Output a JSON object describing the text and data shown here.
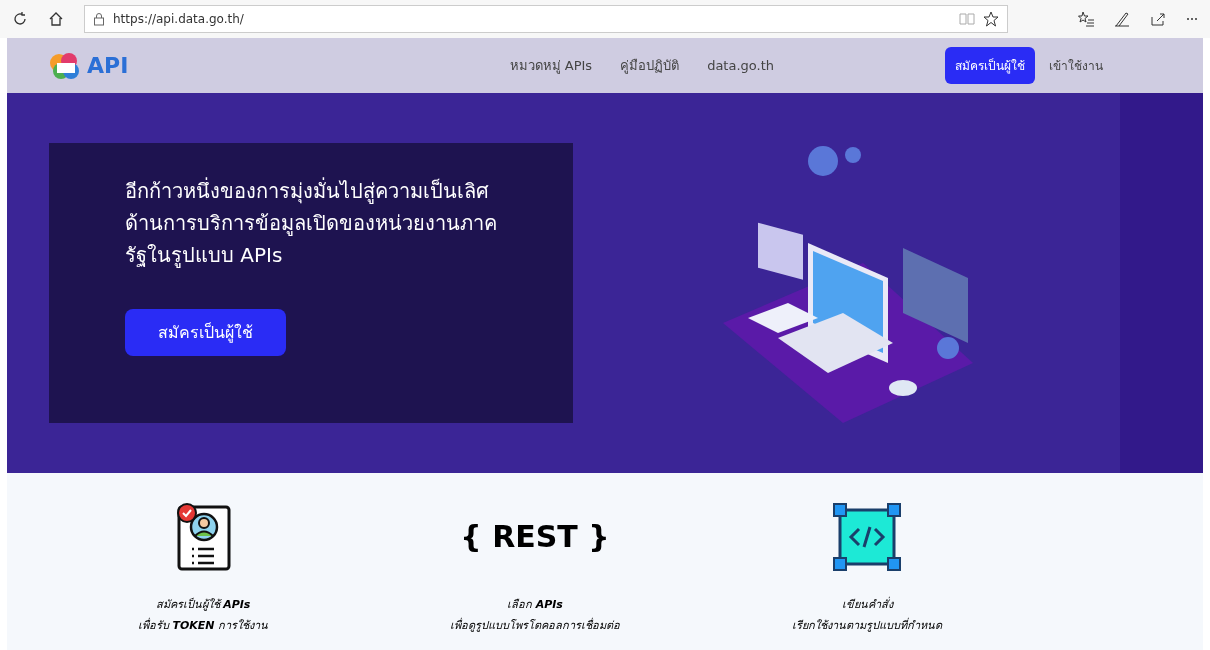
{
  "browser": {
    "url": "https://api.data.go.th/"
  },
  "nav": {
    "logo_text": "API",
    "links": [
      "หมวดหมู่ APIs",
      "คู่มือปฏิบัติ",
      "data.go.th"
    ],
    "register_button": "สมัครเป็นผู้ใช้",
    "login_link": "เข้าใช้งาน"
  },
  "hero": {
    "headline": "อีกก้าวหนึ่งของการมุ่งมั่นไปสู่ความเป็นเลิศด้านการบริการข้อมูลเปิดของหน่วยงานภาครัฐในรูปแบบ APIs",
    "button": "สมัครเป็นผู้ใช้"
  },
  "steps": [
    {
      "kind": "register",
      "title": "สมัครเป็นผู้ใช้ **APIs**",
      "subtitle": "เพื่อรับ **TOKEN** การใช้งาน"
    },
    {
      "kind": "rest",
      "icon_text": "{ REST }",
      "title": "เลือก **APIs**",
      "subtitle": "เพื่อดูรูปแบบโพรโตคอลการเชื่อมต่อ"
    },
    {
      "kind": "code",
      "title": "เขียนคำสั่ง",
      "subtitle": "เรียกใช้งานตามรูปแบบที่กำหนด"
    }
  ]
}
